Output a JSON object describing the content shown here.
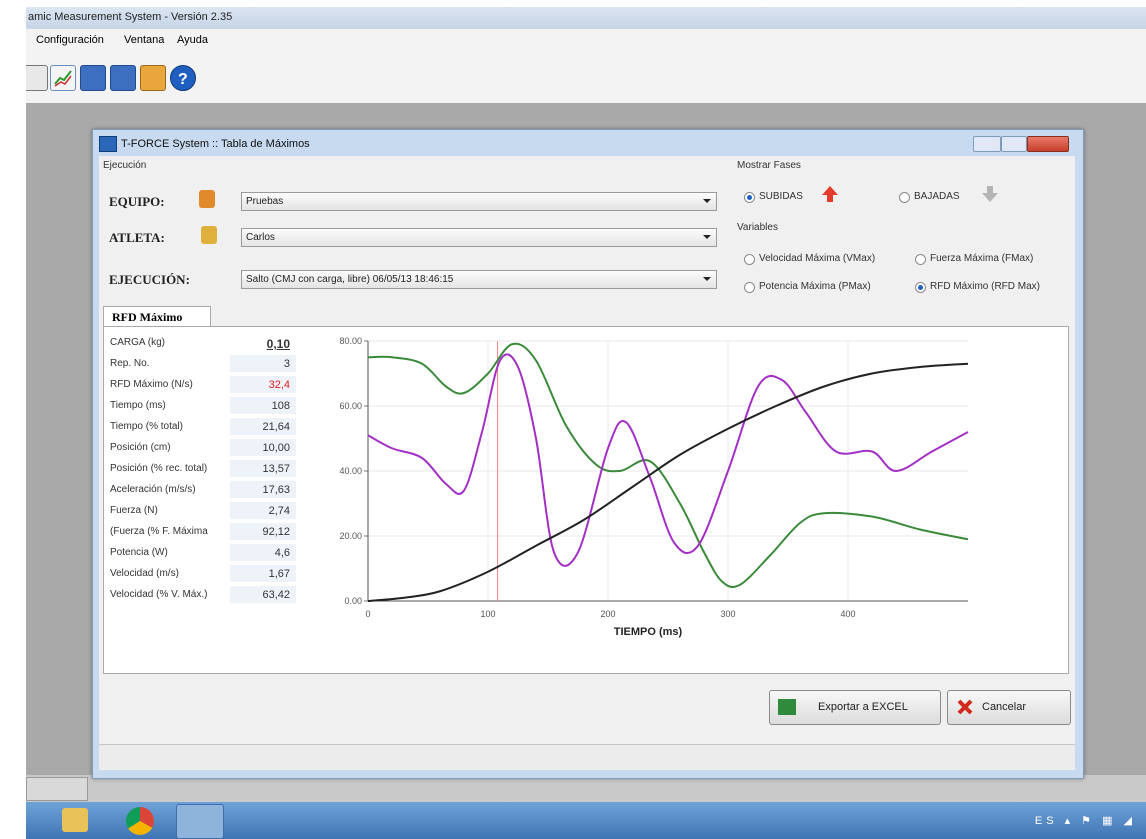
{
  "app": {
    "title": "amic Measurement System - Versión 2.35",
    "menu": [
      "Configuración",
      "Ventana",
      "Ayuda"
    ]
  },
  "window": {
    "title": "T-FORCE System :: Tabla de Máximos",
    "group_ejecucion": "Ejecución",
    "equipo_label": "EQUIPO:",
    "equipo_value": "Pruebas",
    "atleta_label": "ATLETA:",
    "atleta_value": "Carlos",
    "ejecucion_label": "EJECUCIÓN:",
    "ejecucion_value": "Salto (CMJ con carga, libre)   06/05/13   18:46:15",
    "fases_group": "Mostrar Fases",
    "fases": [
      {
        "label": "SUBIDAS",
        "selected": true
      },
      {
        "label": "BAJADAS",
        "selected": false
      }
    ],
    "variables_group": "Variables",
    "variables": [
      {
        "label": "Velocidad Máxima (VMax)",
        "selected": false
      },
      {
        "label": "Fuerza Máxima (FMax)",
        "selected": false
      },
      {
        "label": "Potencia Máxima (PMax)",
        "selected": false
      },
      {
        "label": "RFD Máximo (RFD Max)",
        "selected": true
      }
    ],
    "tab_label": "RFD Máximo",
    "table": [
      {
        "label": "CARGA (kg)",
        "value": "0,10"
      },
      {
        "label": "Rep. No.",
        "value": "3"
      },
      {
        "label": "RFD Máximo (N/s)",
        "value": "32,4"
      },
      {
        "label": "Tiempo (ms)",
        "value": "108"
      },
      {
        "label": "Tiempo (% total)",
        "value": "21,64"
      },
      {
        "label": "Posición (cm)",
        "value": "10,00"
      },
      {
        "label": "Posición (% rec. total)",
        "value": "13,57"
      },
      {
        "label": "Aceleración (m/s/s)",
        "value": "17,63"
      },
      {
        "label": "Fuerza (N)",
        "value": "2,74"
      },
      {
        "label": "(Fuerza (% F. Máxima",
        "value": "92,12"
      },
      {
        "label": "Potencia (W)",
        "value": "4,6"
      },
      {
        "label": "Velocidad (m/s)",
        "value": "1,67"
      },
      {
        "label": "Velocidad (% V. Máx.)",
        "value": "63,42"
      }
    ],
    "export_button": "Exportar a EXCEL",
    "cancel_button": "Cancelar"
  },
  "colors": {
    "green": "#3a8a3a",
    "purple": "#a32fc4",
    "black": "#222222",
    "marker": "#f08080",
    "red_value": "#e02020"
  },
  "chart_data": {
    "type": "line",
    "xlabel": "TIEMPO (ms)",
    "ylabel": "",
    "xlim": [
      0,
      500
    ],
    "ylim": [
      0,
      80
    ],
    "x_ticks": [
      "0",
      "100",
      "200",
      "300",
      "400"
    ],
    "y_ticks": [
      "0.00",
      "20.00",
      "40.00",
      "60.00",
      "80.00"
    ],
    "grid": true,
    "marker_x": 108,
    "series": [
      {
        "color": "#3a8a3a",
        "x": [
          0,
          20,
          45,
          65,
          80,
          100,
          120,
          140,
          165,
          190,
          210,
          235,
          260,
          280,
          295,
          310,
          335,
          360,
          380,
          420,
          460,
          500
        ],
        "y": [
          75,
          75,
          73,
          66,
          64,
          70,
          79,
          74,
          54,
          42,
          40,
          43,
          30,
          15,
          6,
          5,
          14,
          24,
          27,
          26,
          22,
          19
        ]
      },
      {
        "color": "#a32fc4",
        "x": [
          0,
          20,
          45,
          65,
          80,
          95,
          110,
          125,
          140,
          155,
          175,
          200,
          215,
          235,
          255,
          275,
          300,
          325,
          345,
          365,
          390,
          420,
          440,
          470,
          500
        ],
        "y": [
          51,
          47,
          44,
          36,
          34,
          52,
          74,
          72,
          50,
          15,
          15,
          47,
          55,
          38,
          18,
          17,
          40,
          66,
          68,
          58,
          46,
          46,
          40,
          46,
          52
        ]
      },
      {
        "color": "#222222",
        "x": [
          0,
          30,
          60,
          100,
          140,
          180,
          220,
          260,
          300,
          340,
          380,
          420,
          460,
          500
        ],
        "y": [
          0,
          1,
          3,
          9,
          17,
          25,
          35,
          45,
          53,
          60,
          66,
          70,
          72,
          73
        ]
      }
    ]
  }
}
